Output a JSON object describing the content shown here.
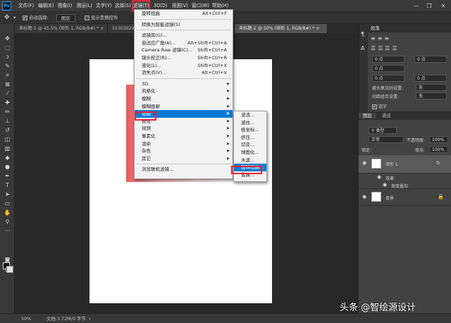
{
  "menubar": {
    "app_logo": "Ps",
    "items": [
      "文件(F)",
      "编辑(E)",
      "图像(I)",
      "图层(L)",
      "文字(Y)",
      "选择(S)",
      "滤镜(T)",
      "3D(D)",
      "视图(V)",
      "窗口(W)",
      "帮助(H)"
    ],
    "window_controls": [
      "—",
      "❐",
      "✕"
    ]
  },
  "options": {
    "auto_select_label": "自动选择:",
    "auto_select_value": "图层",
    "show_transform_label": "显示变换控件"
  },
  "tabs": [
    {
      "label": "未标题-1 @ 45.5% (矩形 1, RGB/8#) *",
      "close": "×"
    },
    {
      "label": "553030297c...",
      "close": "×"
    },
    {
      "label": "未标题-2 @ 50% (矩形 1, RGB/8#) *",
      "close": "×"
    }
  ],
  "filter_menu": {
    "items": [
      {
        "label": "旋转扭曲",
        "shortcut": "Alt+Ctrl+F"
      },
      {
        "sep": true
      },
      {
        "label": "转换为智能滤镜(S)"
      },
      {
        "sep": true
      },
      {
        "label": "滤镜库(G)..."
      },
      {
        "label": "自适应广角(A)...",
        "shortcut": "Alt+Shift+Ctrl+A"
      },
      {
        "label": "Camera Raw 滤镜(C)...",
        "shortcut": "Shift+Ctrl+A"
      },
      {
        "label": "镜头校正(R)...",
        "shortcut": "Shift+Ctrl+R"
      },
      {
        "label": "液化(L)...",
        "shortcut": "Shift+Ctrl+X"
      },
      {
        "label": "消失点(V)...",
        "shortcut": "Alt+Ctrl+V"
      },
      {
        "sep": true
      },
      {
        "label": "3D",
        "sub": true
      },
      {
        "label": "风格化",
        "sub": true
      },
      {
        "label": "模糊",
        "sub": true
      },
      {
        "label": "模糊画廊",
        "sub": true
      },
      {
        "label": "扭曲",
        "sub": true,
        "highlight": true
      },
      {
        "label": "锐化",
        "sub": true
      },
      {
        "label": "视频",
        "sub": true
      },
      {
        "label": "像素化",
        "sub": true
      },
      {
        "label": "渲染",
        "sub": true
      },
      {
        "label": "杂色",
        "sub": true
      },
      {
        "label": "其它",
        "sub": true
      },
      {
        "sep": true
      },
      {
        "label": "浏览联机滤镜..."
      }
    ]
  },
  "distort_menu": {
    "items": [
      {
        "label": "波浪..."
      },
      {
        "label": "波纹..."
      },
      {
        "label": "极坐标..."
      },
      {
        "label": "挤压..."
      },
      {
        "label": "切变..."
      },
      {
        "label": "球面化..."
      },
      {
        "label": "水波..."
      },
      {
        "label": "旋转扭曲...",
        "highlight": true
      },
      {
        "label": "置换..."
      }
    ]
  },
  "properties_panel": {
    "title": "段落",
    "field_1": "0 点",
    "field_2": "0 点",
    "field_3": "0 点",
    "field_4": "0 点",
    "field_5": "0 点",
    "hyphen_label": "避头尾法则设置:",
    "hyphen_value": "无",
    "spacing_label": "间距组合设置:",
    "spacing_value": "无",
    "hyphenate_label": "连字"
  },
  "layers_panel": {
    "tabs": [
      "图层",
      "通道"
    ],
    "filter_kind": "类型",
    "blend_mode": "正常",
    "opacity_label": "不透明度:",
    "opacity_value": "100%",
    "lock_label": "锁定:",
    "fill_label": "填充:",
    "fill_value": "100%",
    "layers": [
      {
        "name": "矩形 1",
        "fx": "fx"
      },
      {
        "name": "效果"
      },
      {
        "name": "渐变叠加"
      },
      {
        "name": "背景"
      }
    ]
  },
  "status": {
    "zoom": "50%",
    "doc": "文档:3.72M/0 字节"
  },
  "watermark": "头条 @智绘源设计"
}
